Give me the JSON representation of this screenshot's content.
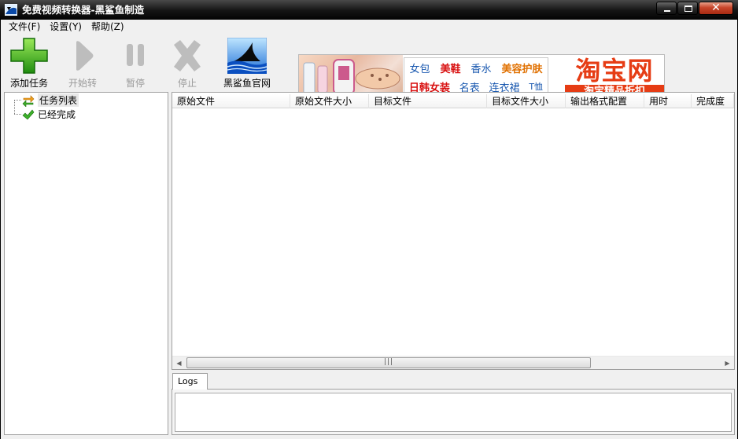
{
  "window": {
    "title": "免费视频转换器-黑鲨鱼制造"
  },
  "menu": [
    {
      "label": "文件(F)"
    },
    {
      "label": "设置(Y)"
    },
    {
      "label": "帮助(Z)"
    }
  ],
  "toolbar": {
    "add": "添加任务",
    "start": "开始转",
    "pause": "暂停",
    "stop": "停止",
    "site": "黑鲨鱼官网"
  },
  "ad": {
    "row1": [
      "女包",
      "美鞋",
      "香水",
      "美容护肤"
    ],
    "row2": [
      "日韩女装",
      "名表",
      "连衣裙",
      "T恤"
    ],
    "logo": "淘宝网",
    "slogan": "淘宝精品折扣",
    "brand_color": "#e63c14"
  },
  "tree": {
    "items": [
      {
        "label": "任务列表",
        "icon": "swap-arrows-icon"
      },
      {
        "label": "已经完成",
        "icon": "checkmark-icon"
      }
    ]
  },
  "list": {
    "columns": [
      "原始文件",
      "原始文件大小",
      "目标文件",
      "目标文件大小",
      "输出格式配置",
      "用时",
      "完成度"
    ],
    "rows": []
  },
  "logs": {
    "tab": "Logs"
  }
}
